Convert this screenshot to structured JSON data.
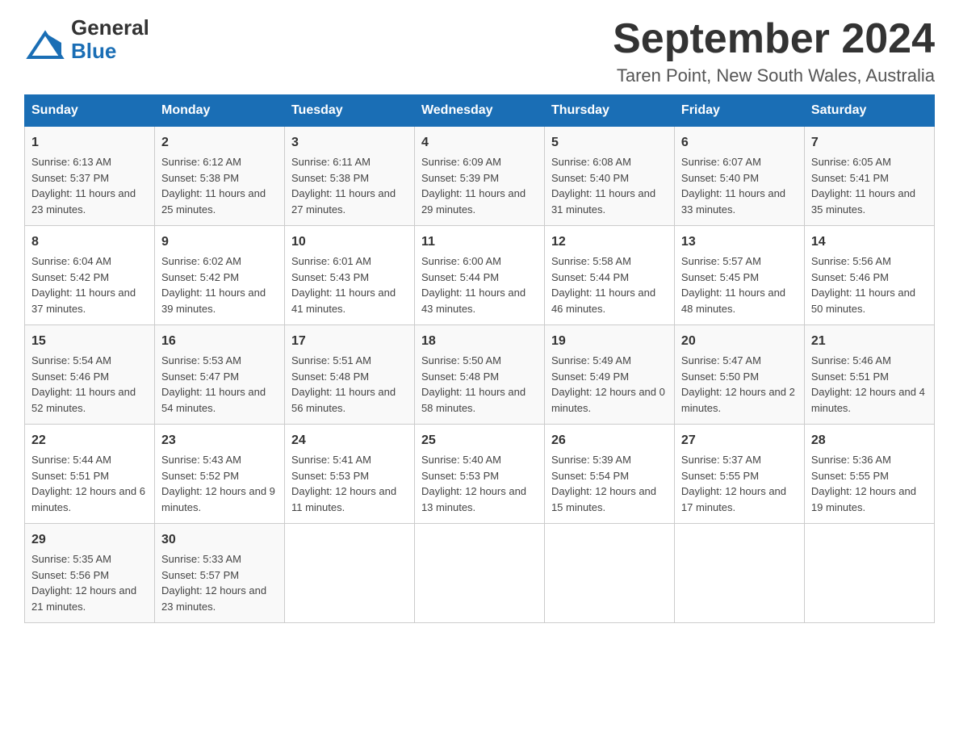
{
  "header": {
    "logo_general": "General",
    "logo_blue": "Blue",
    "month_title": "September 2024",
    "location": "Taren Point, New South Wales, Australia"
  },
  "weekdays": [
    "Sunday",
    "Monday",
    "Tuesday",
    "Wednesday",
    "Thursday",
    "Friday",
    "Saturday"
  ],
  "weeks": [
    [
      {
        "day": "1",
        "sunrise": "6:13 AM",
        "sunset": "5:37 PM",
        "daylight": "11 hours and 23 minutes."
      },
      {
        "day": "2",
        "sunrise": "6:12 AM",
        "sunset": "5:38 PM",
        "daylight": "11 hours and 25 minutes."
      },
      {
        "day": "3",
        "sunrise": "6:11 AM",
        "sunset": "5:38 PM",
        "daylight": "11 hours and 27 minutes."
      },
      {
        "day": "4",
        "sunrise": "6:09 AM",
        "sunset": "5:39 PM",
        "daylight": "11 hours and 29 minutes."
      },
      {
        "day": "5",
        "sunrise": "6:08 AM",
        "sunset": "5:40 PM",
        "daylight": "11 hours and 31 minutes."
      },
      {
        "day": "6",
        "sunrise": "6:07 AM",
        "sunset": "5:40 PM",
        "daylight": "11 hours and 33 minutes."
      },
      {
        "day": "7",
        "sunrise": "6:05 AM",
        "sunset": "5:41 PM",
        "daylight": "11 hours and 35 minutes."
      }
    ],
    [
      {
        "day": "8",
        "sunrise": "6:04 AM",
        "sunset": "5:42 PM",
        "daylight": "11 hours and 37 minutes."
      },
      {
        "day": "9",
        "sunrise": "6:02 AM",
        "sunset": "5:42 PM",
        "daylight": "11 hours and 39 minutes."
      },
      {
        "day": "10",
        "sunrise": "6:01 AM",
        "sunset": "5:43 PM",
        "daylight": "11 hours and 41 minutes."
      },
      {
        "day": "11",
        "sunrise": "6:00 AM",
        "sunset": "5:44 PM",
        "daylight": "11 hours and 43 minutes."
      },
      {
        "day": "12",
        "sunrise": "5:58 AM",
        "sunset": "5:44 PM",
        "daylight": "11 hours and 46 minutes."
      },
      {
        "day": "13",
        "sunrise": "5:57 AM",
        "sunset": "5:45 PM",
        "daylight": "11 hours and 48 minutes."
      },
      {
        "day": "14",
        "sunrise": "5:56 AM",
        "sunset": "5:46 PM",
        "daylight": "11 hours and 50 minutes."
      }
    ],
    [
      {
        "day": "15",
        "sunrise": "5:54 AM",
        "sunset": "5:46 PM",
        "daylight": "11 hours and 52 minutes."
      },
      {
        "day": "16",
        "sunrise": "5:53 AM",
        "sunset": "5:47 PM",
        "daylight": "11 hours and 54 minutes."
      },
      {
        "day": "17",
        "sunrise": "5:51 AM",
        "sunset": "5:48 PM",
        "daylight": "11 hours and 56 minutes."
      },
      {
        "day": "18",
        "sunrise": "5:50 AM",
        "sunset": "5:48 PM",
        "daylight": "11 hours and 58 minutes."
      },
      {
        "day": "19",
        "sunrise": "5:49 AM",
        "sunset": "5:49 PM",
        "daylight": "12 hours and 0 minutes."
      },
      {
        "day": "20",
        "sunrise": "5:47 AM",
        "sunset": "5:50 PM",
        "daylight": "12 hours and 2 minutes."
      },
      {
        "day": "21",
        "sunrise": "5:46 AM",
        "sunset": "5:51 PM",
        "daylight": "12 hours and 4 minutes."
      }
    ],
    [
      {
        "day": "22",
        "sunrise": "5:44 AM",
        "sunset": "5:51 PM",
        "daylight": "12 hours and 6 minutes."
      },
      {
        "day": "23",
        "sunrise": "5:43 AM",
        "sunset": "5:52 PM",
        "daylight": "12 hours and 9 minutes."
      },
      {
        "day": "24",
        "sunrise": "5:41 AM",
        "sunset": "5:53 PM",
        "daylight": "12 hours and 11 minutes."
      },
      {
        "day": "25",
        "sunrise": "5:40 AM",
        "sunset": "5:53 PM",
        "daylight": "12 hours and 13 minutes."
      },
      {
        "day": "26",
        "sunrise": "5:39 AM",
        "sunset": "5:54 PM",
        "daylight": "12 hours and 15 minutes."
      },
      {
        "day": "27",
        "sunrise": "5:37 AM",
        "sunset": "5:55 PM",
        "daylight": "12 hours and 17 minutes."
      },
      {
        "day": "28",
        "sunrise": "5:36 AM",
        "sunset": "5:55 PM",
        "daylight": "12 hours and 19 minutes."
      }
    ],
    [
      {
        "day": "29",
        "sunrise": "5:35 AM",
        "sunset": "5:56 PM",
        "daylight": "12 hours and 21 minutes."
      },
      {
        "day": "30",
        "sunrise": "5:33 AM",
        "sunset": "5:57 PM",
        "daylight": "12 hours and 23 minutes."
      },
      null,
      null,
      null,
      null,
      null
    ]
  ],
  "labels": {
    "sunrise": "Sunrise:",
    "sunset": "Sunset:",
    "daylight": "Daylight:"
  }
}
